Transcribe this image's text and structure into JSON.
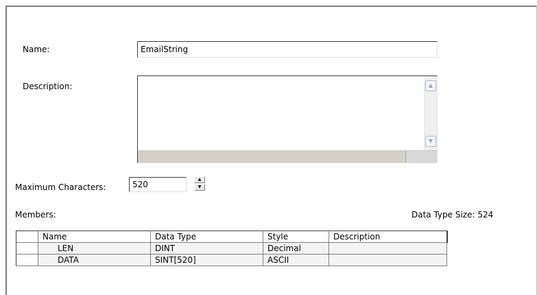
{
  "form": {
    "name_label": "Name:",
    "name_value": "EmailString",
    "description_label": "Description:",
    "description_value": "",
    "max_chars_label": "Maximum Characters:",
    "max_chars_value": "520",
    "members_label": "Members:",
    "data_type_size": "Data Type Size: 524"
  },
  "members_table": {
    "columns": [
      "Name",
      "Data Type",
      "Style",
      "Description"
    ],
    "rows": [
      {
        "name": "LEN",
        "data_type": "DINT",
        "style": "Decimal",
        "description": ""
      },
      {
        "name": "DATA",
        "data_type": "SINT[520]",
        "style": "ASCII",
        "description": ""
      }
    ]
  }
}
